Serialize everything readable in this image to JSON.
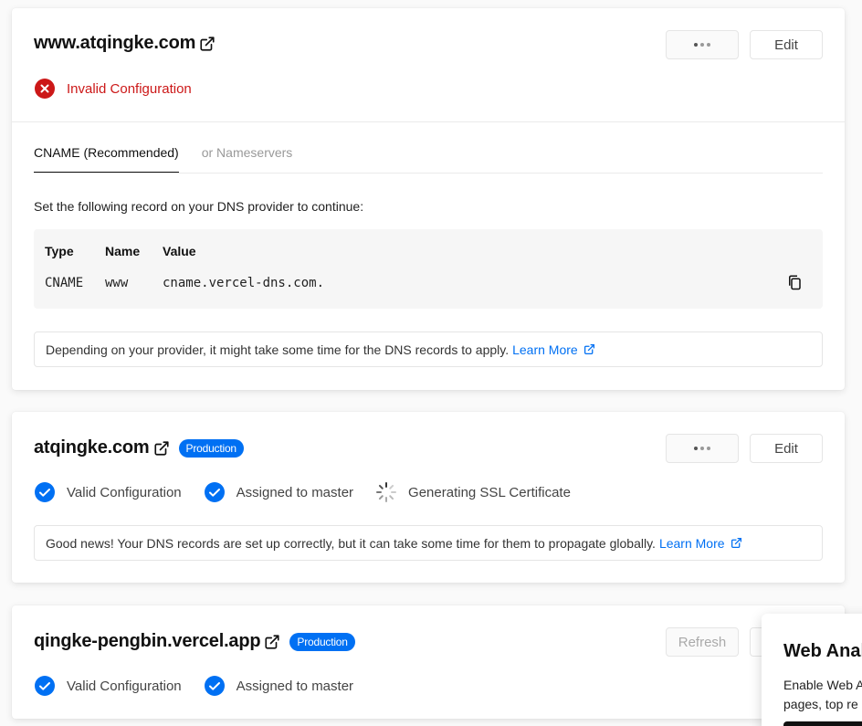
{
  "domains": [
    {
      "name": "www.atqingke.com",
      "edit_label": "Edit",
      "status": {
        "label": "Invalid Configuration",
        "color": "#cc1818",
        "icon": "x-circle-icon"
      },
      "tabs": [
        {
          "label": "CNAME (Recommended)",
          "active": true
        },
        {
          "label": "or Nameservers",
          "active": false
        }
      ],
      "instruction": "Set the following record on your DNS provider to continue:",
      "record": {
        "headers": {
          "type": "Type",
          "name": "Name",
          "value": "Value"
        },
        "type": "CNAME",
        "name": "www",
        "value": "cname.vercel-dns.com."
      },
      "note": "Depending on your provider, it might take some time for the DNS records to apply.",
      "learn_more": "Learn More"
    },
    {
      "name": "atqingke.com",
      "badge": "Production",
      "edit_label": "Edit",
      "statuses": [
        {
          "label": "Valid Configuration",
          "icon": "check-circle-icon"
        },
        {
          "label": "Assigned to master",
          "icon": "check-circle-icon"
        },
        {
          "label": "Generating SSL Certificate",
          "icon": "spinner-icon"
        }
      ],
      "note": "Good news! Your DNS records are set up correctly, but it can take some time for them to propagate globally.",
      "learn_more": "Learn More"
    },
    {
      "name": "qingke-pengbin.vercel.app",
      "badge": "Production",
      "refresh_label": "Refresh",
      "statuses": [
        {
          "label": "Valid Configuration",
          "icon": "check-circle-icon"
        },
        {
          "label": "Assigned to master",
          "icon": "check-circle-icon"
        }
      ]
    }
  ],
  "popup": {
    "title": "Web Anal",
    "body_line1": "Enable Web A",
    "body_line2": "pages, top re"
  },
  "colors": {
    "accent": "#0070f3",
    "error": "#cc1818"
  }
}
